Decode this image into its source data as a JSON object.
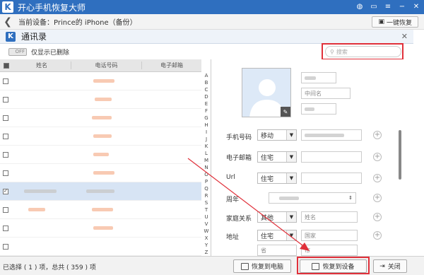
{
  "app": {
    "title": "开心手机恢复大师",
    "logo": "K"
  },
  "device": {
    "label": "当前设备：Prince的 iPhone（备份）",
    "oneclick_label": "一键恢复"
  },
  "dialog": {
    "title": "通讯录",
    "logo": "K"
  },
  "toolbar": {
    "toggle_text": "OFF",
    "toggle_label": "仅显示已删除",
    "search_placeholder": "搜索"
  },
  "list": {
    "headers": [
      "姓名",
      "电话号码",
      "电子邮箱"
    ],
    "alphabet": [
      "A",
      "B",
      "C",
      "D",
      "E",
      "F",
      "G",
      "H",
      "I",
      "J",
      "K",
      "L",
      "M",
      "N",
      "O",
      "P",
      "Q",
      "R",
      "S",
      "T",
      "U",
      "V",
      "W",
      "X",
      "Y",
      "Z"
    ]
  },
  "detail": {
    "middle_name_placeholder": "中间名",
    "labels": {
      "phone": "手机号码",
      "email": "电子邮箱",
      "url": "Url",
      "anniversary": "周年",
      "relation": "家庭关系",
      "address": "地址"
    },
    "selects": {
      "phone_type": "移动",
      "email_type": "住宅",
      "url_type": "住宅",
      "relation_type": "其他",
      "address_type": "住宅"
    },
    "placeholders": {
      "relation_name": "姓名",
      "country": "国家",
      "province": "省",
      "city": "市"
    }
  },
  "status": {
    "text": "已选择 ( 1 ) 项，总共 ( 359 ) 项"
  },
  "buttons": {
    "restore_pc": "恢复到电脑",
    "restore_device": "恢复到设备",
    "close": "关闭"
  },
  "colors": {
    "titlebar": "#2f6fbf",
    "highlight": "#e0303a"
  }
}
